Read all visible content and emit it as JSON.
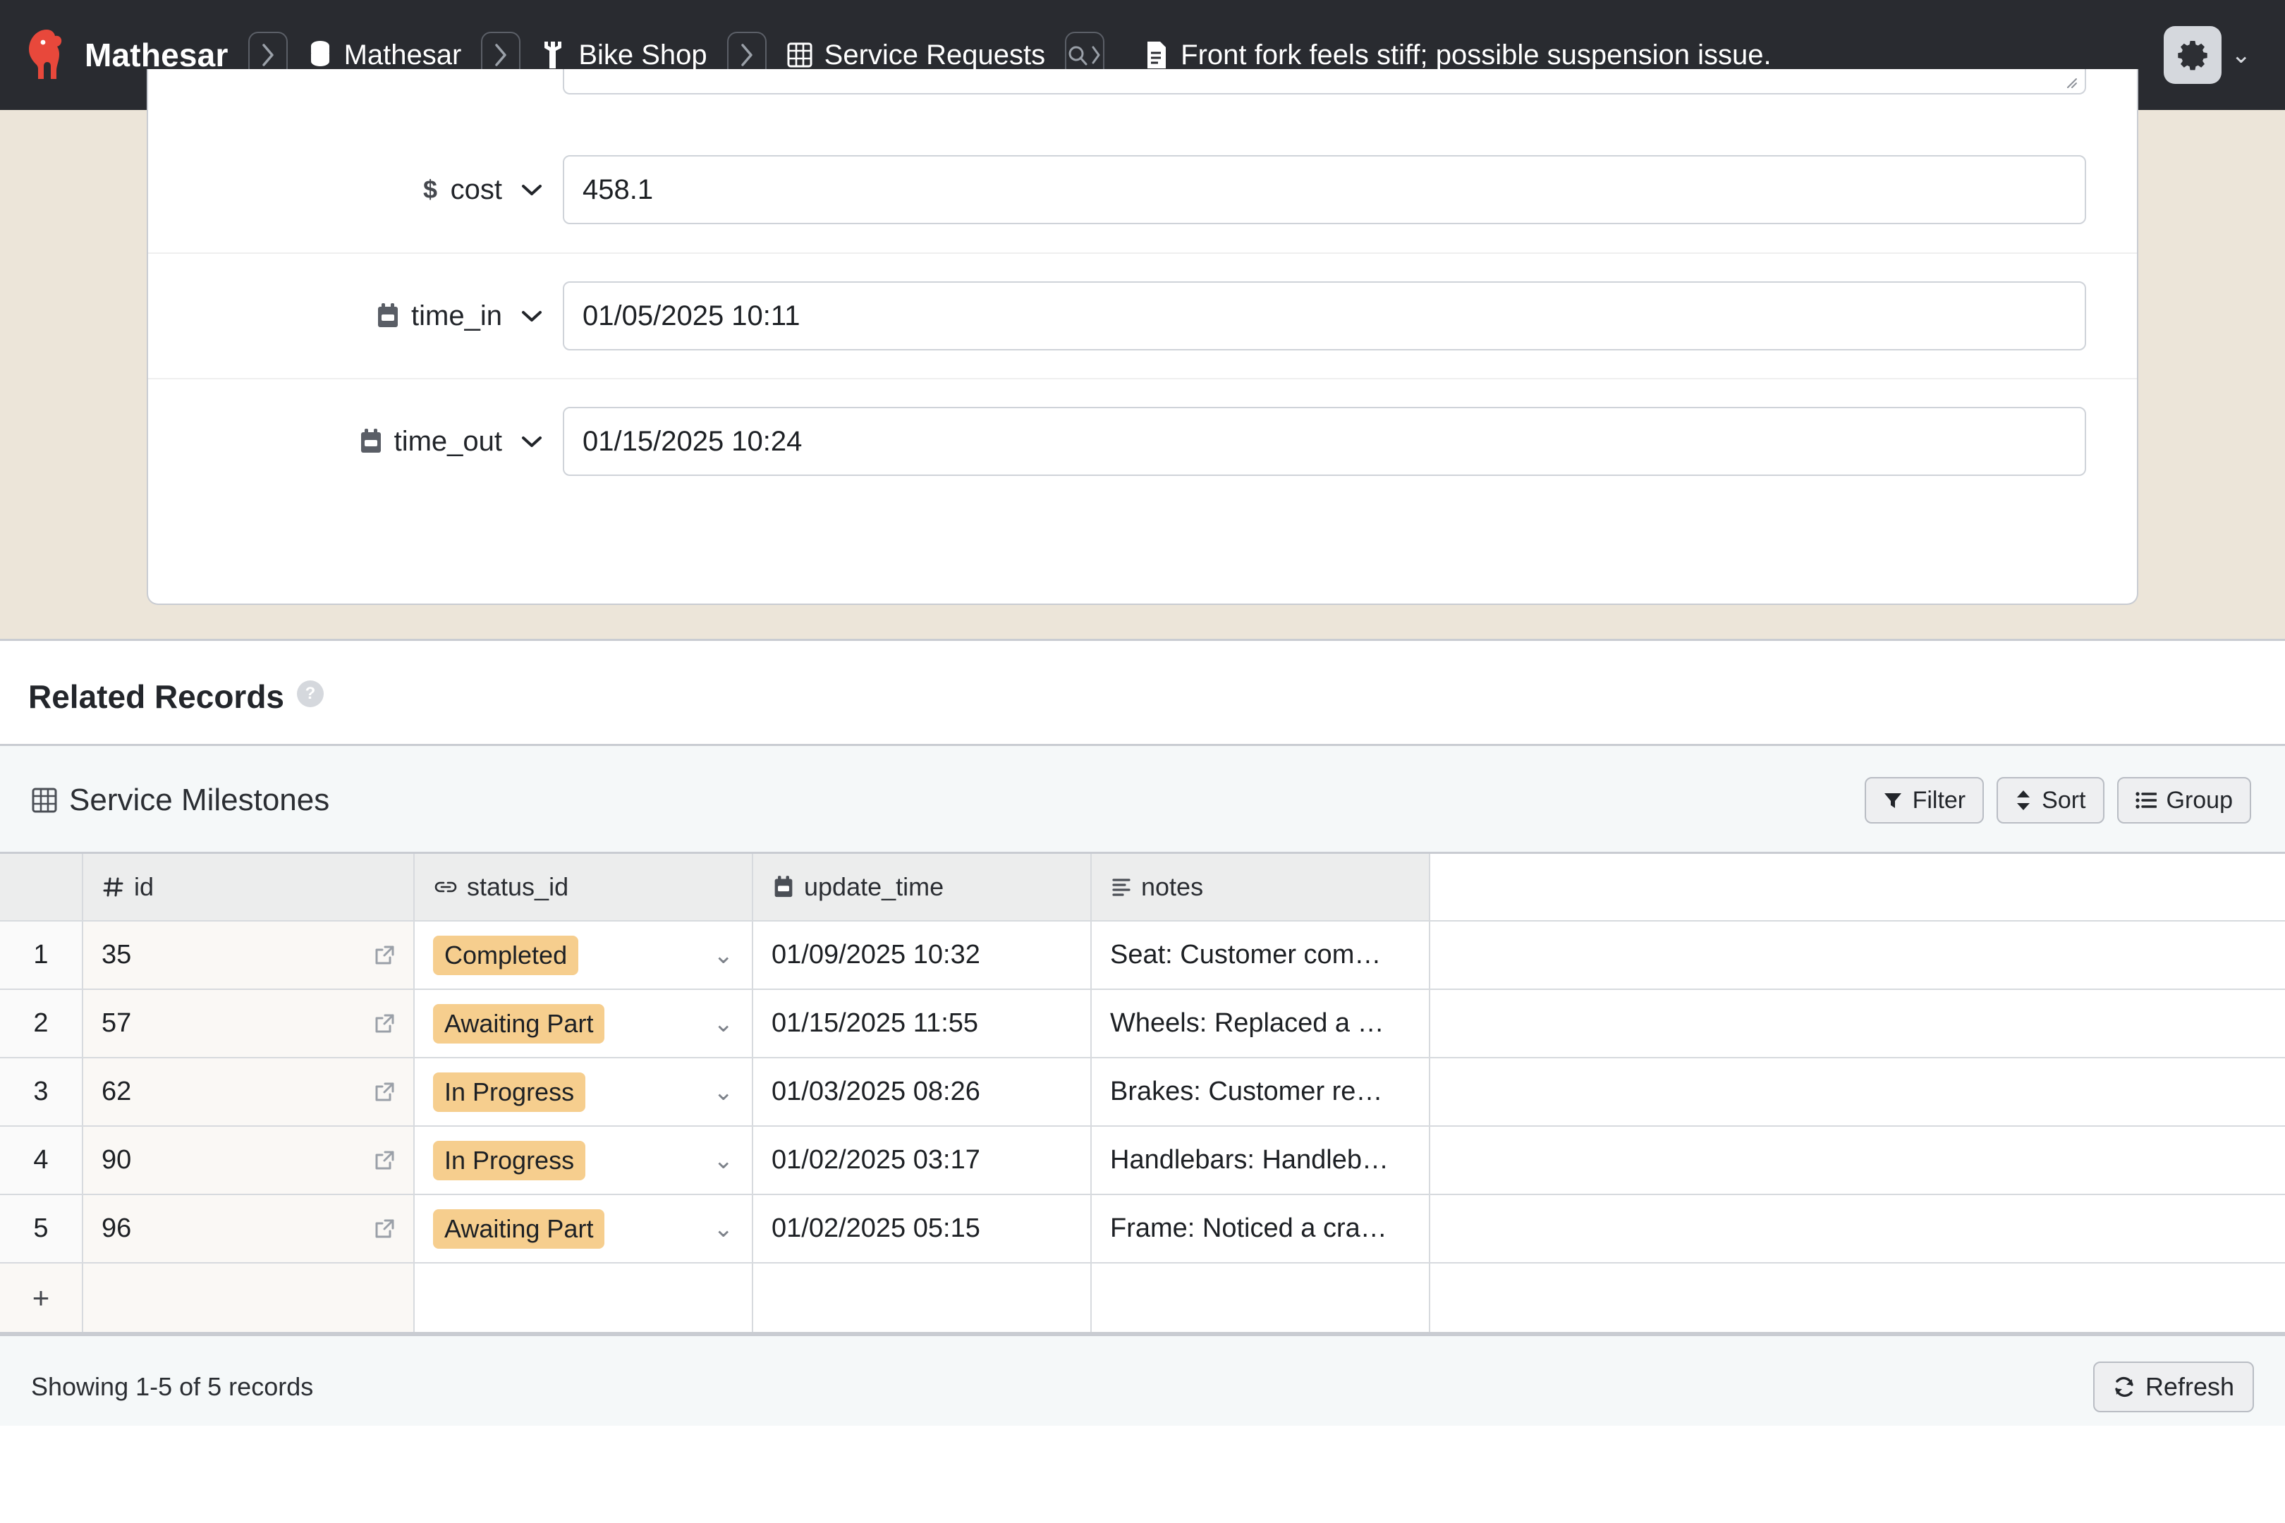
{
  "topbar": {
    "logo_icon": "mathesar-elephant-logo",
    "brand": "Mathesar",
    "separator_icon": "chevron-right-icon",
    "breadcrumbs": [
      {
        "icon": "database-icon",
        "label": "Mathesar"
      },
      {
        "icon": "wrench-icon",
        "label": "Bike Shop"
      },
      {
        "icon": "table-icon",
        "label": "Service Requests"
      }
    ],
    "search_icon": "search-icon",
    "record_icon": "record-document-icon",
    "record_title": "Front fork feels stiff; possible suspension issue.",
    "settings_icon": "gear-icon",
    "settings_chevron": "chevron-down-icon"
  },
  "record_form": {
    "fields": [
      {
        "icon": "currency-dollar-icon",
        "label": "cost",
        "chevron": "chevron-down-icon",
        "value": "458.1"
      },
      {
        "icon": "calendar-icon",
        "label": "time_in",
        "chevron": "chevron-down-icon",
        "value": "01/05/2025 10:11"
      },
      {
        "icon": "calendar-icon",
        "label": "time_out",
        "chevron": "chevron-down-icon",
        "value": "01/15/2025 10:24"
      }
    ]
  },
  "related_records": {
    "title": "Related Records",
    "help_glyph": "?"
  },
  "table": {
    "icon": "table-icon",
    "name": "Service Milestones",
    "actions": [
      {
        "icon": "filter-icon",
        "label": "Filter"
      },
      {
        "icon": "sort-icon",
        "label": "Sort"
      },
      {
        "icon": "group-icon",
        "label": "Group"
      }
    ],
    "columns": [
      {
        "icon": "hash-icon",
        "label": "id"
      },
      {
        "icon": "link-icon",
        "label": "status_id"
      },
      {
        "icon": "calendar-icon",
        "label": "update_time"
      },
      {
        "icon": "text-lines-icon",
        "label": "notes"
      }
    ],
    "rows": [
      {
        "n": "1",
        "id": "35",
        "status": "Completed",
        "update_time": "01/09/2025 10:32",
        "notes": "Seat: Customer com…"
      },
      {
        "n": "2",
        "id": "57",
        "status": "Awaiting Part",
        "update_time": "01/15/2025 11:55",
        "notes": "Wheels: Replaced a …"
      },
      {
        "n": "3",
        "id": "62",
        "status": "In Progress",
        "update_time": "01/03/2025 08:26",
        "notes": "Brakes: Customer re…"
      },
      {
        "n": "4",
        "id": "90",
        "status": "In Progress",
        "update_time": "01/02/2025 03:17",
        "notes": "Handlebars: Handleb…"
      },
      {
        "n": "5",
        "id": "96",
        "status": "Awaiting Part",
        "update_time": "01/02/2025 05:15",
        "notes": "Frame: Noticed a cra…"
      }
    ],
    "new_row_glyph": "+",
    "footer_text": "Showing 1-5 of 5 records",
    "refresh_label": "Refresh",
    "refresh_icon": "refresh-icon",
    "badge_color": "#f6ce8e"
  }
}
